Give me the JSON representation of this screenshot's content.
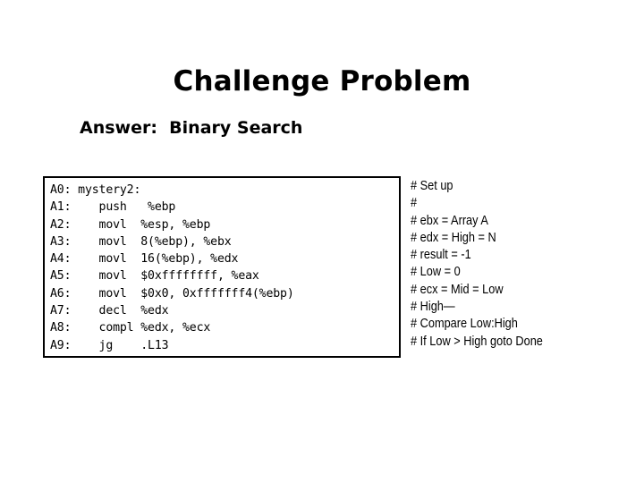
{
  "slide": {
    "title": "Challenge Problem",
    "subtitle": "Answer:  Binary Search",
    "background_color": "#ffffff",
    "text_color": "#000000"
  },
  "code_panel": {
    "border_color": "#000000",
    "lines": [
      {
        "label": "A0:",
        "text": "A0: mystery2:"
      },
      {
        "label": "A1:",
        "text": "A1:    push   %ebp"
      },
      {
        "label": "A2:",
        "text": "A2:    movl  %esp, %ebp"
      },
      {
        "label": "A3:",
        "text": "A3:    movl  8(%ebp), %ebx"
      },
      {
        "label": "A4:",
        "text": "A4:    movl  16(%ebp), %edx"
      },
      {
        "label": "A5:",
        "text": "A5:    movl  $0xffffffff, %eax"
      },
      {
        "label": "A6:",
        "text": "A6:    movl  $0x0, 0xfffffff4(%ebp)"
      },
      {
        "label": "A7:",
        "text": "A7:    decl  %edx"
      },
      {
        "label": "A8:",
        "text": "A8:    compl %edx, %ecx"
      },
      {
        "label": "A9:",
        "text": "A9:    jg    .L13"
      }
    ]
  },
  "comments": {
    "lines": [
      "# Set up",
      "#",
      "# ebx = Array A",
      "# edx = High = N",
      "# result = -1",
      "# Low = 0",
      "# ecx = Mid = Low",
      "# High—",
      "# Compare Low:High",
      "# If Low > High goto Done"
    ]
  }
}
